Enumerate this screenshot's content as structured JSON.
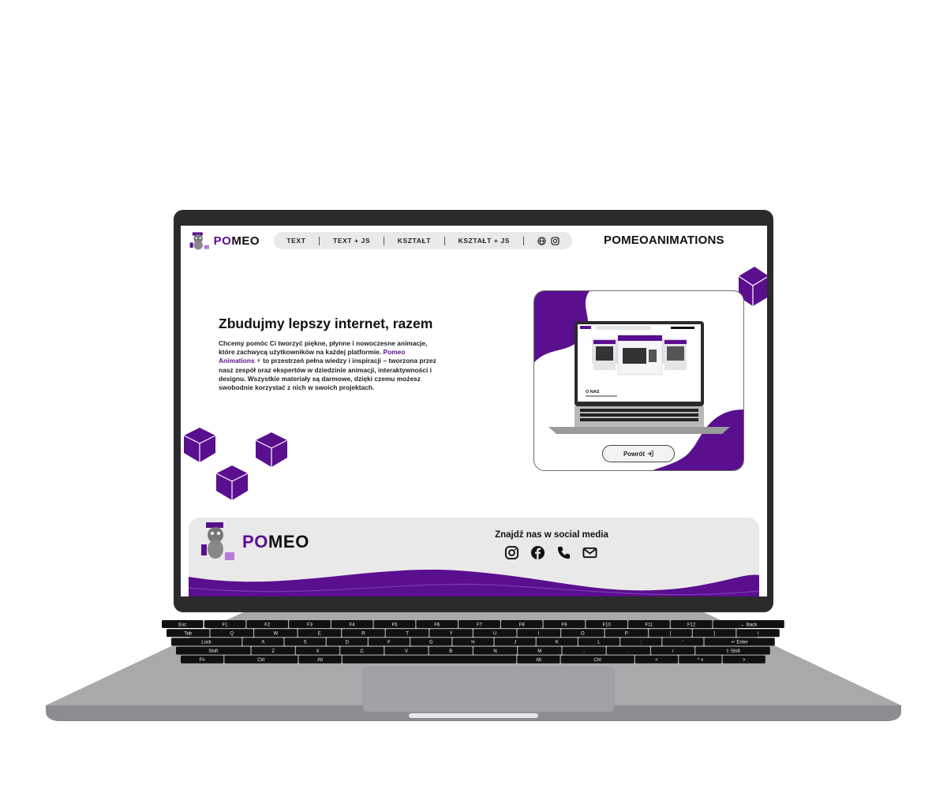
{
  "header": {
    "logo_text_accent": "PO",
    "logo_text_rest": "MEO",
    "nav": [
      {
        "label": "TEXT"
      },
      {
        "label": "TEXT + JS"
      },
      {
        "label": "KSZTAŁT"
      },
      {
        "label": "KSZTAŁT + JS"
      }
    ],
    "nav_icons": [
      "globe-icon",
      "instagram-icon"
    ],
    "brand_name": "POMEOANIMATIONS"
  },
  "hero": {
    "title": "Zbudujmy lepszy internet, razem",
    "text_before": "Chcemy pomóc Ci tworzyć piękne, płynne i nowoczesne animacje, które zachwycą użytkowników na każdej platformie. ",
    "highlight": "Pomeo Animations",
    "text_after": " to przestrzeń pełna wiedzy i inspiracji – tworzona przez nasz zespół oraz ekspertów w dziedzinie animacji, interaktywności i designu. Wszystkie materiały są darmowe, dzięki czemu możesz swobodnie korzystać z nich w swoich projektach."
  },
  "showcase": {
    "back_button": "Powrót",
    "preview_heading": "O NAS"
  },
  "footer": {
    "logo_text_accent": "PO",
    "logo_text_rest": "MEO",
    "social_title": "Znajdź nas w social media",
    "social_icons": [
      "instagram-icon",
      "facebook-icon",
      "phone-icon",
      "mail-icon"
    ]
  },
  "keyboard": {
    "rows": [
      [
        "Esc",
        "F1",
        "F2",
        "F3",
        "F4",
        "F5",
        "F6",
        "F7",
        "F8",
        "F9",
        "F10",
        "F11",
        "F12",
        "← Back"
      ],
      [
        "Tab",
        "Q",
        "W",
        "E",
        "R",
        "T",
        "Y",
        "U",
        "I",
        "O",
        "P",
        "[",
        "]",
        "\\"
      ],
      [
        "Lock",
        "A",
        "S",
        "D",
        "F",
        "G",
        "H",
        "J",
        "K",
        "L",
        ";",
        "'",
        "↵ Enter"
      ],
      [
        "Shift",
        "Z",
        "X",
        "C",
        "V",
        "B",
        "N",
        "M",
        ",",
        ".",
        "/",
        "⇧ Shift"
      ],
      [
        "Fn",
        "Ctrl",
        "Alt",
        "",
        "Alt",
        "Ctrl",
        "<",
        "^ v",
        ">"
      ]
    ]
  },
  "colors": {
    "accent": "#5a0f8f",
    "panel": "#e9e9e9",
    "dark": "#111111"
  }
}
